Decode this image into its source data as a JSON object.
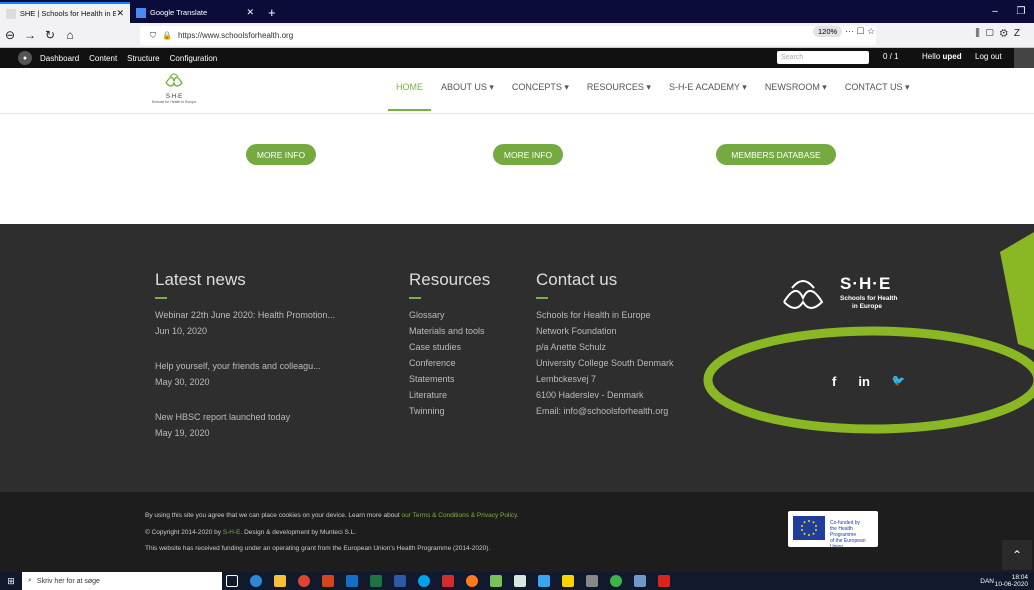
{
  "browser": {
    "tabs": [
      {
        "label": "SHE | Schools for Health in Europe",
        "active": true
      },
      {
        "label": "Google Translate",
        "active": false
      }
    ],
    "new_tab": "+",
    "url": "https://www.schoolsforhealth.org",
    "zoom": "120%",
    "url_actions": "··· ☐ ☆"
  },
  "admin": {
    "items": [
      "Dashboard",
      "Content",
      "Structure",
      "Configuration"
    ],
    "search_placeholder": "Search",
    "count": "0 / 1",
    "hello": "Hello",
    "user": "uped",
    "logout": "Log out"
  },
  "site": {
    "logo_title": "S·H·E",
    "logo_sub": "Schools for Health in Europe",
    "nav": [
      {
        "label": "HOME",
        "active": true
      },
      {
        "label": "ABOUT US ▾"
      },
      {
        "label": "CONCEPTS ▾"
      },
      {
        "label": "RESOURCES ▾"
      },
      {
        "label": "S-H-E ACADEMY ▾"
      },
      {
        "label": "NEWSROOM ▾"
      },
      {
        "label": "CONTACT US ▾"
      }
    ],
    "buttons": [
      "MORE INFO",
      "MORE INFO",
      "MEMBERS DATABASE"
    ]
  },
  "footer": {
    "news_title": "Latest news",
    "news": [
      {
        "title": "Webinar 22th June 2020: Health Promotion...",
        "date": "Jun 10, 2020"
      },
      {
        "title": "Help yourself, your friends and colleagu...",
        "date": "May 30, 2020"
      },
      {
        "title": "New HBSC report launched today",
        "date": "May 19, 2020"
      }
    ],
    "resources_title": "Resources",
    "resources": [
      "Glossary",
      "Materials and tools",
      "Case studies",
      "Conference",
      "Statements",
      "Literature",
      "Twinning"
    ],
    "contact_title": "Contact us",
    "contact": [
      "Schools for Health in Europe",
      "Network Foundation",
      "p/a Anette Schulz",
      "University College South Denmark",
      "Lembckesvej 7",
      "6100 Haderslev - Denmark",
      "Email: info@schoolsforhealth.org"
    ],
    "brand_title": "S·H·E",
    "brand_sub1": "Schools for Health",
    "brand_sub2": "in Europe",
    "social": [
      "f",
      "in",
      "🐦"
    ],
    "cookie_text": "By using this site you agree that we can place cookies on your device. Learn more about",
    "cookie_link": "our Terms & Conditions & Privacy Policy.",
    "copyright_pre": "© Copyright 2014-2020 by",
    "copyright_link": "S-H-E.",
    "copyright_post": "Design & development by Munteci S.L.",
    "funding": "This website has received funding under an operating grant from the European Union's Health Programme (2014-2020).",
    "eu_line1": "Co-funded by",
    "eu_line2": "the Health Programme",
    "eu_line3": "of the European Union"
  },
  "taskbar": {
    "search_placeholder": "Skriv her for at søge",
    "lang": "DAN",
    "time": "18:04",
    "date": "10-06-2020"
  },
  "colors": {
    "brand_green": "#74aa3f",
    "footer_bg": "#2e2e2e",
    "annotation": "#8ab824"
  }
}
